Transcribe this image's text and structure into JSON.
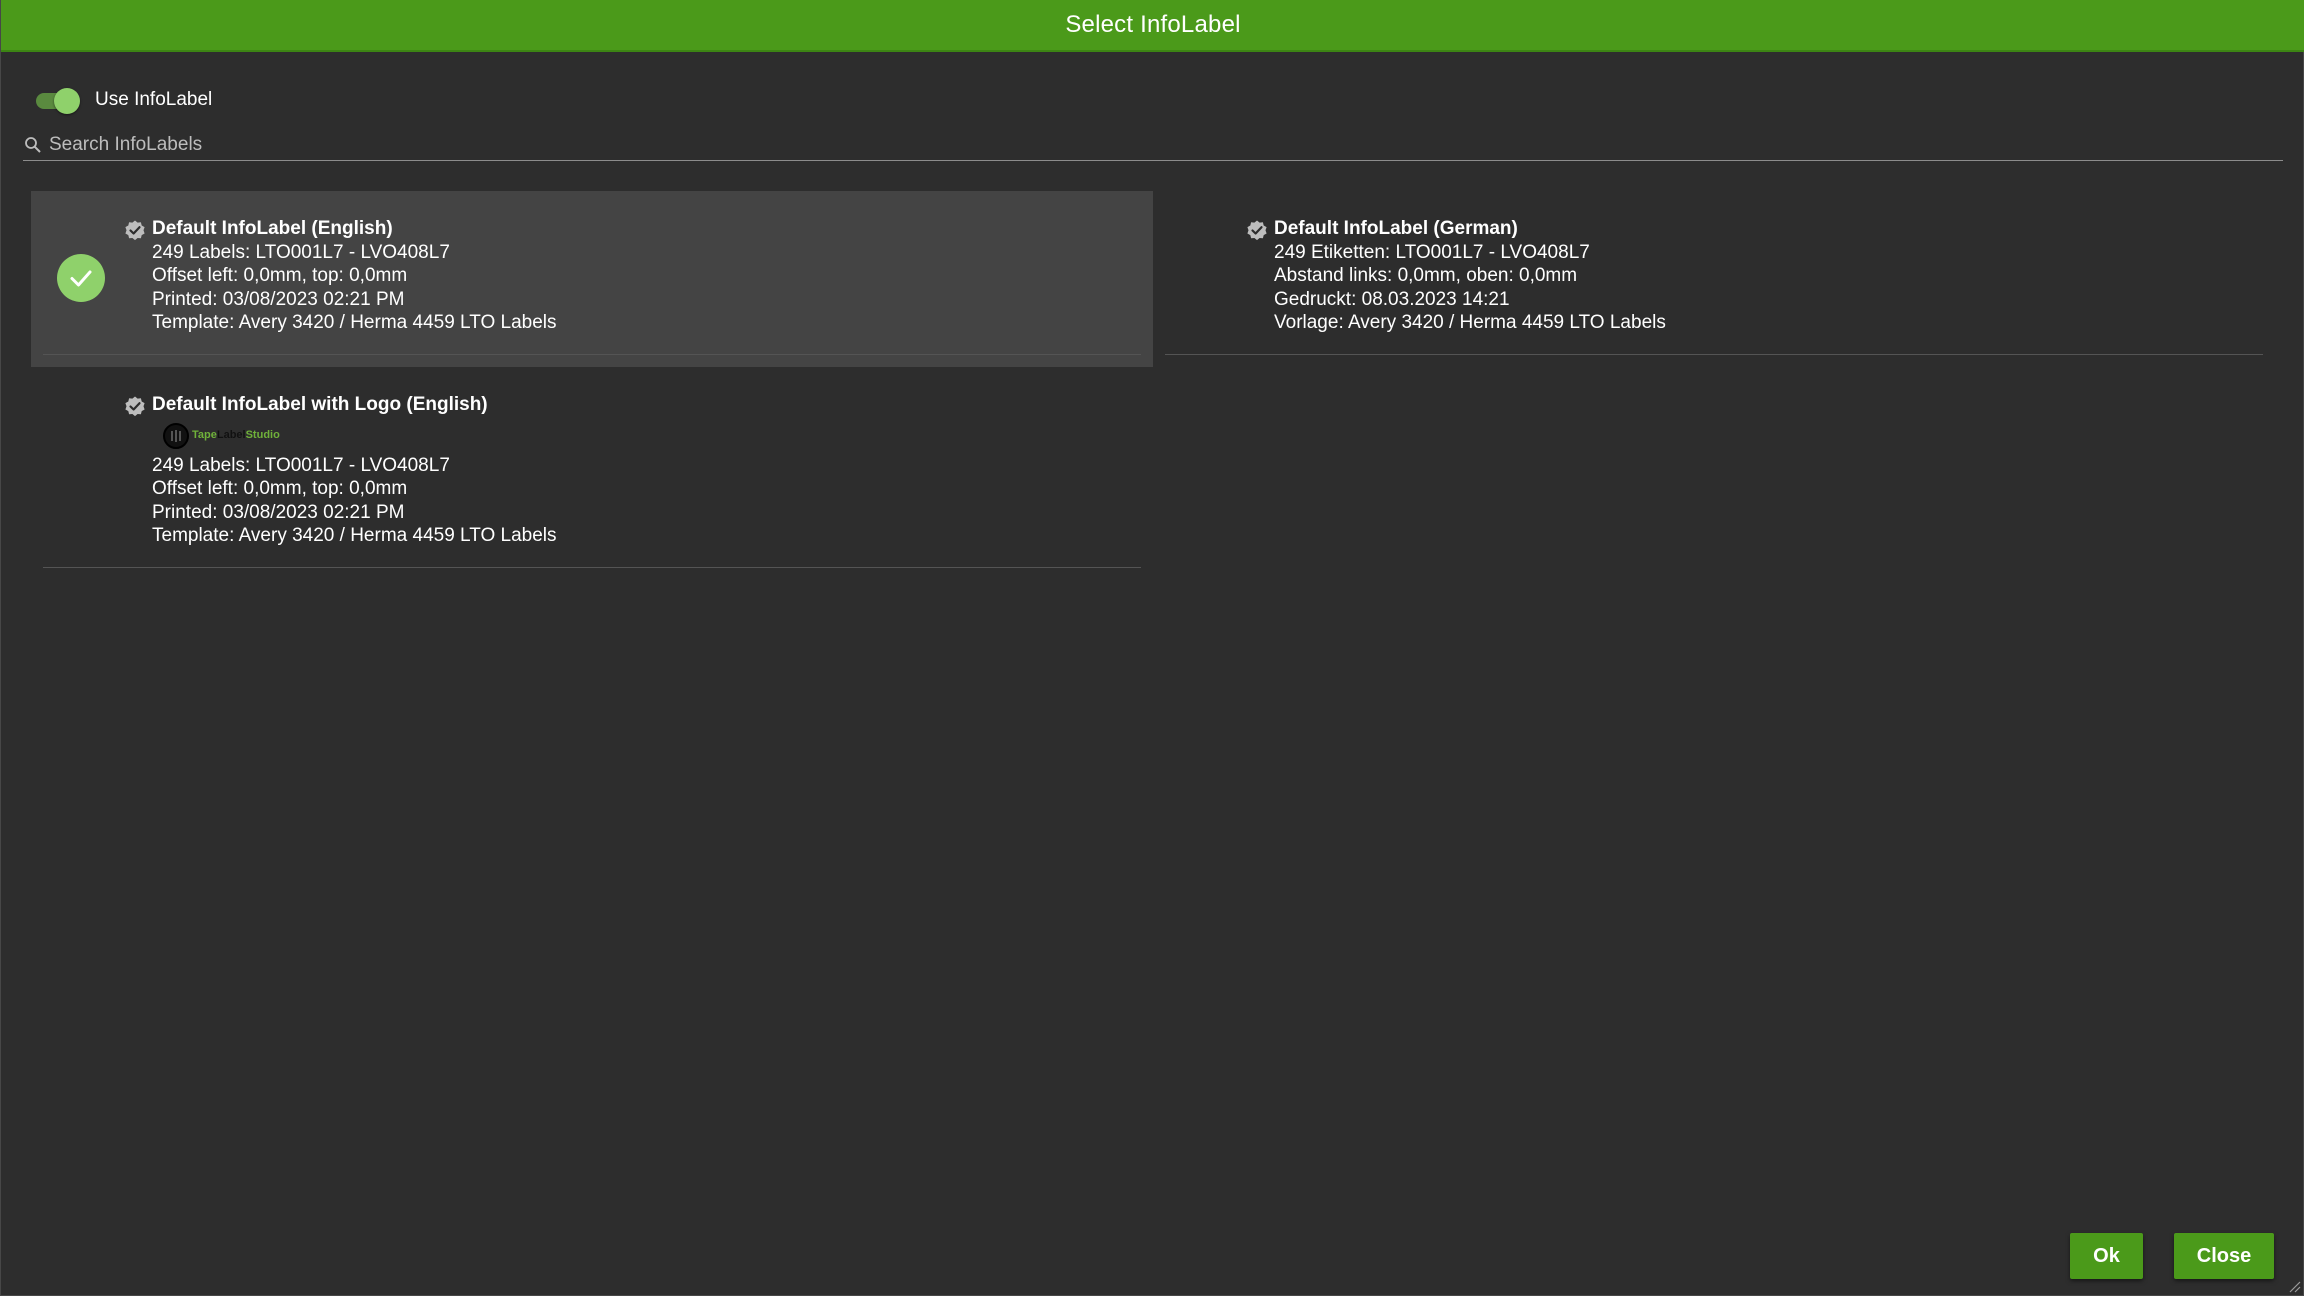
{
  "window": {
    "title": "Select InfoLabel"
  },
  "toggle": {
    "label": "Use InfoLabel",
    "checked": true
  },
  "search": {
    "placeholder": "Search InfoLabels",
    "value": ""
  },
  "labels": [
    {
      "name": "Default InfoLabel (English)",
      "selected": true,
      "lines": [
        "249 Labels: LTO001L7 - LVO408L7",
        "Offset left: 0,0mm, top: 0,0mm",
        "Printed: 03/08/2023 02:21 PM",
        "Template: Avery 3420 / Herma 4459 LTO Labels"
      ]
    },
    {
      "name": "Default InfoLabel (German)",
      "selected": false,
      "lines": [
        "249 Etiketten: LTO001L7 - LVO408L7",
        "Abstand links: 0,0mm, oben: 0,0mm",
        "Gedruckt: 08.03.2023 14:21",
        "Vorlage: Avery 3420 / Herma 4459 LTO Labels"
      ]
    },
    {
      "name": "Default InfoLabel with Logo (English)",
      "selected": false,
      "logo": {
        "part1": "Tape",
        "part2": "Label",
        "part3": "Studio"
      },
      "lines": [
        "249 Labels: LTO001L7 - LVO408L7",
        "Offset left: 0,0mm, top: 0,0mm",
        "Printed: 03/08/2023 02:21 PM",
        "Template: Avery 3420 / Herma 4459 LTO Labels"
      ]
    }
  ],
  "buttons": {
    "ok": "Ok",
    "close": "Close"
  },
  "colors": {
    "accent": "#4b9a1a",
    "check": "#8fd16b",
    "background": "#2d2d2d",
    "selected_row": "#444444"
  },
  "icons": {
    "search": "search-icon",
    "verified": "verified-badge-icon",
    "check": "checkmark-icon",
    "resize": "resize-grip-icon"
  }
}
